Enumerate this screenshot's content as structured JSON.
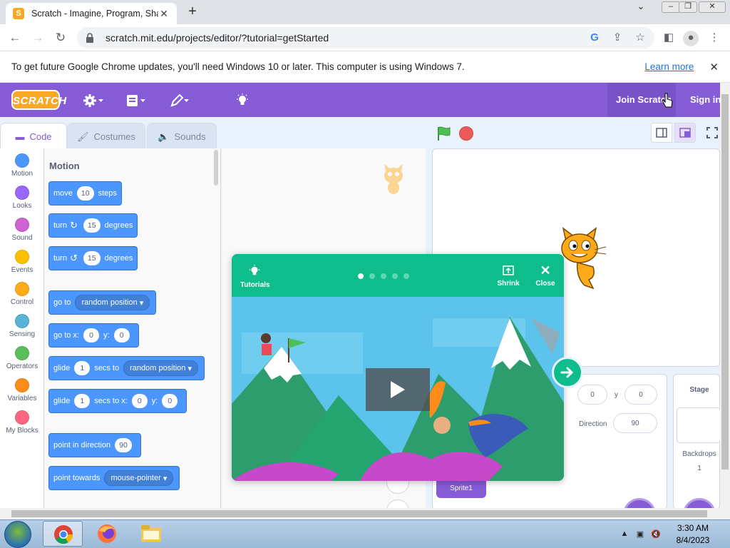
{
  "browser": {
    "tab_title": "Scratch - Imagine, Program, Shar",
    "tab_favicon": "scratch-cat-icon",
    "url": "scratch.mit.edu/projects/editor/?tutorial=getStarted",
    "infobar_message": "To get future Google Chrome updates, you'll need Windows 10 or later. This computer is using Windows 7.",
    "infobar_link": "Learn more"
  },
  "scratch": {
    "logo": "SCRATCH",
    "menu_icons": [
      "settings-gear-icon",
      "file-menu-icon",
      "edit-menu-icon",
      "tutorials-bulb-icon"
    ],
    "join_label": "Join Scratch",
    "signin_label": "Sign in",
    "tabs": {
      "code": "Code",
      "costumes": "Costumes",
      "sounds": "Sounds"
    },
    "categories": [
      {
        "label": "Motion",
        "color": "#4c97ff"
      },
      {
        "label": "Looks",
        "color": "#9966ff"
      },
      {
        "label": "Sound",
        "color": "#cf63cf"
      },
      {
        "label": "Events",
        "color": "#ffbf00"
      },
      {
        "label": "Control",
        "color": "#ffab19"
      },
      {
        "label": "Sensing",
        "color": "#5cb1d6"
      },
      {
        "label": "Operators",
        "color": "#59c059"
      },
      {
        "label": "Variables",
        "color": "#ff8c1a"
      },
      {
        "label": "My Blocks",
        "color": "#ff6680"
      }
    ],
    "palette_header": "Motion",
    "blocks": {
      "move": {
        "a": "move",
        "v": "10",
        "b": "steps"
      },
      "turn_right": {
        "a": "turn",
        "v": "15",
        "b": "degrees"
      },
      "turn_left": {
        "a": "turn",
        "v": "15",
        "b": "degrees"
      },
      "goto": {
        "a": "go to",
        "menu": "random position"
      },
      "goto_xy": {
        "a": "go to x:",
        "x": "0",
        "ylbl": "y:",
        "y": "0"
      },
      "glide": {
        "a": "glide",
        "v": "1",
        "b": "secs to",
        "menu": "random position"
      },
      "glide_xy": {
        "a": "glide",
        "v": "1",
        "b": "secs to x:",
        "x": "0",
        "ylbl": "y:",
        "y": "0"
      },
      "point_dir": {
        "a": "point in direction",
        "v": "90"
      },
      "point_towards": {
        "a": "point towards",
        "menu": "mouse-pointer"
      }
    },
    "sprite_info": {
      "x": "0",
      "y_label": "y",
      "y": "0",
      "direction_label": "Direction",
      "direction": "90",
      "sprite_name": "Sprite1"
    },
    "stage_panel": {
      "title": "Stage",
      "backdrops_label": "Backdrops",
      "backdrops_count": "1"
    }
  },
  "tutorial": {
    "tutorials_label": "Tutorials",
    "shrink_label": "Shrink",
    "close_label": "Close",
    "page_count": 5,
    "current_page": 1
  },
  "taskbar": {
    "time": "3:30 AM",
    "date": "8/4/2023",
    "apps": [
      "chrome-icon",
      "firefox-icon",
      "file-explorer-icon"
    ]
  },
  "colors": {
    "scratch_purple": "#855cd6",
    "motion_blue": "#4c97ff",
    "tutorial_green": "#0fbd8c"
  }
}
